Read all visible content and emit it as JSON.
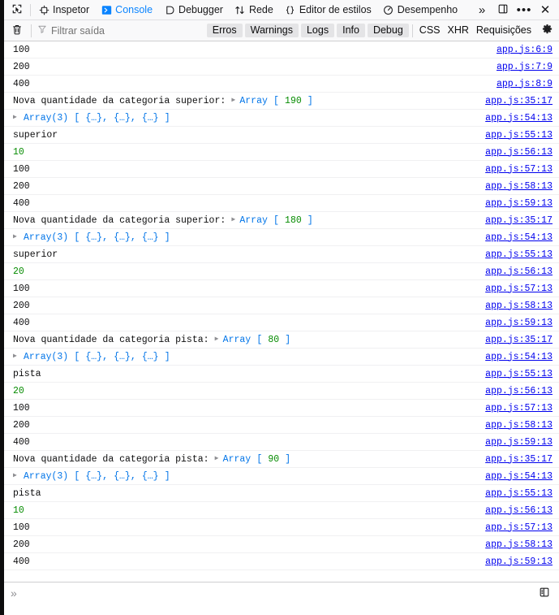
{
  "toolbox": {
    "picker_icon": "element-picker-icon",
    "tabs": [
      {
        "label": "Inspetor",
        "icon": "inspector-icon",
        "active": false
      },
      {
        "label": "Console",
        "icon": "console-chevron-icon",
        "active": true
      },
      {
        "label": "Debugger",
        "icon": "debugger-icon",
        "active": false
      },
      {
        "label": "Rede",
        "icon": "network-arrows-icon",
        "active": false
      },
      {
        "label": "Editor de estilos",
        "icon": "style-editor-braces-icon",
        "active": false
      },
      {
        "label": "Desempenho",
        "icon": "performance-gauge-icon",
        "active": false
      }
    ],
    "overflow_icon": "chevron-double-right-icon",
    "dock_icon": "dock-panel-icon",
    "meatball_icon": "ellipsis-icon",
    "close_icon": "close-x-icon",
    "active_tab_color": "#0a84ff"
  },
  "filterbar": {
    "clear_icon": "trash-icon",
    "filter_icon": "funnel-icon",
    "filter_placeholder": "Filtrar saída",
    "filter_value": "",
    "severity_buttons": [
      "Erros",
      "Warnings",
      "Logs",
      "Info",
      "Debug"
    ],
    "request_buttons": [
      "CSS",
      "XHR",
      "Requisições"
    ],
    "settings_icon": "gear-icon"
  },
  "console": {
    "rows": [
      {
        "parts": [
          {
            "t": "txt",
            "v": "100"
          }
        ],
        "source": "app.js:6:9"
      },
      {
        "parts": [
          {
            "t": "txt",
            "v": "200"
          }
        ],
        "source": "app.js:7:9"
      },
      {
        "parts": [
          {
            "t": "txt",
            "v": "400"
          }
        ],
        "source": "app.js:8:9"
      },
      {
        "parts": [
          {
            "t": "txt",
            "v": "Nova quantidade da categoria superior:"
          },
          {
            "t": "sp"
          },
          {
            "t": "arrow"
          },
          {
            "t": "objname",
            "v": "Array"
          },
          {
            "t": "sp"
          },
          {
            "t": "brack",
            "v": "["
          },
          {
            "t": "sp"
          },
          {
            "t": "num",
            "v": "190"
          },
          {
            "t": "sp"
          },
          {
            "t": "brack",
            "v": "]"
          }
        ],
        "source": "app.js:35:17"
      },
      {
        "parts": [
          {
            "t": "arrow-ind"
          },
          {
            "t": "objname",
            "v": "Array(3)"
          },
          {
            "t": "sp"
          },
          {
            "t": "brack",
            "v": "["
          },
          {
            "t": "sp"
          },
          {
            "t": "objstub",
            "v": "{…}"
          },
          {
            "t": "brack",
            "v": ","
          },
          {
            "t": "sp"
          },
          {
            "t": "objstub",
            "v": "{…}"
          },
          {
            "t": "brack",
            "v": ","
          },
          {
            "t": "sp"
          },
          {
            "t": "objstub",
            "v": "{…}"
          },
          {
            "t": "sp"
          },
          {
            "t": "brack",
            "v": "]"
          }
        ],
        "source": "app.js:54:13"
      },
      {
        "parts": [
          {
            "t": "txt",
            "v": "superior"
          }
        ],
        "source": "app.js:55:13"
      },
      {
        "parts": [
          {
            "t": "num",
            "v": "10"
          }
        ],
        "source": "app.js:56:13"
      },
      {
        "parts": [
          {
            "t": "txt",
            "v": "100"
          }
        ],
        "source": "app.js:57:13"
      },
      {
        "parts": [
          {
            "t": "txt",
            "v": "200"
          }
        ],
        "source": "app.js:58:13"
      },
      {
        "parts": [
          {
            "t": "txt",
            "v": "400"
          }
        ],
        "source": "app.js:59:13"
      },
      {
        "parts": [
          {
            "t": "txt",
            "v": "Nova quantidade da categoria superior:"
          },
          {
            "t": "sp"
          },
          {
            "t": "arrow"
          },
          {
            "t": "objname",
            "v": "Array"
          },
          {
            "t": "sp"
          },
          {
            "t": "brack",
            "v": "["
          },
          {
            "t": "sp"
          },
          {
            "t": "num",
            "v": "180"
          },
          {
            "t": "sp"
          },
          {
            "t": "brack",
            "v": "]"
          }
        ],
        "source": "app.js:35:17"
      },
      {
        "parts": [
          {
            "t": "arrow-ind"
          },
          {
            "t": "objname",
            "v": "Array(3)"
          },
          {
            "t": "sp"
          },
          {
            "t": "brack",
            "v": "["
          },
          {
            "t": "sp"
          },
          {
            "t": "objstub",
            "v": "{…}"
          },
          {
            "t": "brack",
            "v": ","
          },
          {
            "t": "sp"
          },
          {
            "t": "objstub",
            "v": "{…}"
          },
          {
            "t": "brack",
            "v": ","
          },
          {
            "t": "sp"
          },
          {
            "t": "objstub",
            "v": "{…}"
          },
          {
            "t": "sp"
          },
          {
            "t": "brack",
            "v": "]"
          }
        ],
        "source": "app.js:54:13"
      },
      {
        "parts": [
          {
            "t": "txt",
            "v": "superior"
          }
        ],
        "source": "app.js:55:13"
      },
      {
        "parts": [
          {
            "t": "num",
            "v": "20"
          }
        ],
        "source": "app.js:56:13"
      },
      {
        "parts": [
          {
            "t": "txt",
            "v": "100"
          }
        ],
        "source": "app.js:57:13"
      },
      {
        "parts": [
          {
            "t": "txt",
            "v": "200"
          }
        ],
        "source": "app.js:58:13"
      },
      {
        "parts": [
          {
            "t": "txt",
            "v": "400"
          }
        ],
        "source": "app.js:59:13"
      },
      {
        "parts": [
          {
            "t": "txt",
            "v": "Nova quantidade da categoria pista:"
          },
          {
            "t": "sp"
          },
          {
            "t": "arrow"
          },
          {
            "t": "objname",
            "v": "Array"
          },
          {
            "t": "sp"
          },
          {
            "t": "brack",
            "v": "["
          },
          {
            "t": "sp"
          },
          {
            "t": "num",
            "v": "80"
          },
          {
            "t": "sp"
          },
          {
            "t": "brack",
            "v": "]"
          }
        ],
        "source": "app.js:35:17"
      },
      {
        "parts": [
          {
            "t": "arrow-ind"
          },
          {
            "t": "objname",
            "v": "Array(3)"
          },
          {
            "t": "sp"
          },
          {
            "t": "brack",
            "v": "["
          },
          {
            "t": "sp"
          },
          {
            "t": "objstub",
            "v": "{…}"
          },
          {
            "t": "brack",
            "v": ","
          },
          {
            "t": "sp"
          },
          {
            "t": "objstub",
            "v": "{…}"
          },
          {
            "t": "brack",
            "v": ","
          },
          {
            "t": "sp"
          },
          {
            "t": "objstub",
            "v": "{…}"
          },
          {
            "t": "sp"
          },
          {
            "t": "brack",
            "v": "]"
          }
        ],
        "source": "app.js:54:13"
      },
      {
        "parts": [
          {
            "t": "txt",
            "v": "pista"
          }
        ],
        "source": "app.js:55:13"
      },
      {
        "parts": [
          {
            "t": "num",
            "v": "20"
          }
        ],
        "source": "app.js:56:13"
      },
      {
        "parts": [
          {
            "t": "txt",
            "v": "100"
          }
        ],
        "source": "app.js:57:13"
      },
      {
        "parts": [
          {
            "t": "txt",
            "v": "200"
          }
        ],
        "source": "app.js:58:13"
      },
      {
        "parts": [
          {
            "t": "txt",
            "v": "400"
          }
        ],
        "source": "app.js:59:13"
      },
      {
        "parts": [
          {
            "t": "txt",
            "v": "Nova quantidade da categoria pista:"
          },
          {
            "t": "sp"
          },
          {
            "t": "arrow"
          },
          {
            "t": "objname",
            "v": "Array"
          },
          {
            "t": "sp"
          },
          {
            "t": "brack",
            "v": "["
          },
          {
            "t": "sp"
          },
          {
            "t": "num",
            "v": "90"
          },
          {
            "t": "sp"
          },
          {
            "t": "brack",
            "v": "]"
          }
        ],
        "source": "app.js:35:17"
      },
      {
        "parts": [
          {
            "t": "arrow-ind"
          },
          {
            "t": "objname",
            "v": "Array(3)"
          },
          {
            "t": "sp"
          },
          {
            "t": "brack",
            "v": "["
          },
          {
            "t": "sp"
          },
          {
            "t": "objstub",
            "v": "{…}"
          },
          {
            "t": "brack",
            "v": ","
          },
          {
            "t": "sp"
          },
          {
            "t": "objstub",
            "v": "{…}"
          },
          {
            "t": "brack",
            "v": ","
          },
          {
            "t": "sp"
          },
          {
            "t": "objstub",
            "v": "{…}"
          },
          {
            "t": "sp"
          },
          {
            "t": "brack",
            "v": "]"
          }
        ],
        "source": "app.js:54:13"
      },
      {
        "parts": [
          {
            "t": "txt",
            "v": "pista"
          }
        ],
        "source": "app.js:55:13"
      },
      {
        "parts": [
          {
            "t": "num",
            "v": "10"
          }
        ],
        "source": "app.js:56:13"
      },
      {
        "parts": [
          {
            "t": "txt",
            "v": "100"
          }
        ],
        "source": "app.js:57:13"
      },
      {
        "parts": [
          {
            "t": "txt",
            "v": "200"
          }
        ],
        "source": "app.js:58:13"
      },
      {
        "parts": [
          {
            "t": "txt",
            "v": "400"
          }
        ],
        "source": "app.js:59:13"
      }
    ]
  },
  "prompt": {
    "chevron": "»",
    "value": "",
    "split_icon": "split-console-icon"
  },
  "colors": {
    "accent": "#0a84ff",
    "link": "#0000ee",
    "number": "#058b00",
    "object": "#0074e8",
    "toolbar_bg": "#f9f9fa"
  }
}
